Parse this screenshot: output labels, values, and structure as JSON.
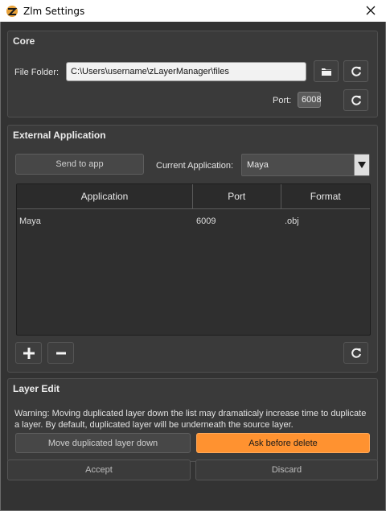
{
  "window": {
    "title": "Zlm Settings"
  },
  "core": {
    "title": "Core",
    "file_folder_label": "File Folder:",
    "file_folder_value": "C:\\Users\\username\\zLayerManager\\files",
    "port_label": "Port:",
    "port_value": "6008"
  },
  "external": {
    "title": "External Application",
    "send_button": "Send to app",
    "current_app_label": "Current Application:",
    "current_app_value": "Maya",
    "columns": [
      "Application",
      "Port",
      "Format"
    ],
    "rows": [
      {
        "application": "Maya",
        "port": "6009",
        "format": ".obj"
      }
    ]
  },
  "layer_edit": {
    "title": "Layer Edit",
    "warning": "Warning: Moving duplicated layer down the list may dramaticaly increase time to duplicate a layer.  By default, duplicated layer will be underneath the source layer.",
    "move_down_button": "Move duplicated layer down",
    "ask_delete_button": "Ask before delete"
  },
  "footer": {
    "accept": "Accept",
    "discard": "Discard"
  },
  "colors": {
    "accent": "#ff9230",
    "background": "#333333",
    "panel": "#3a3a3a"
  },
  "icons": [
    "app-icon",
    "close-icon",
    "folder-icon",
    "refresh-icon",
    "plus-icon",
    "minus-icon",
    "chevron-down-icon"
  ]
}
